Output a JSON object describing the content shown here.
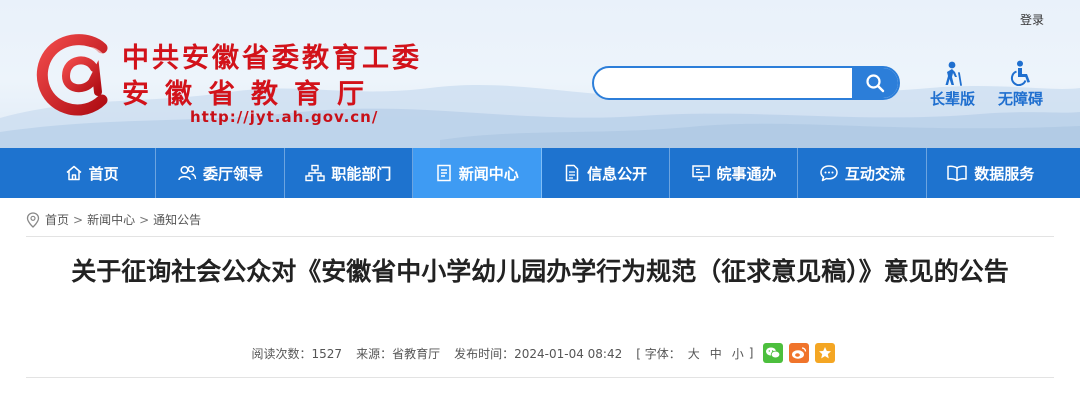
{
  "header": {
    "login": "登录",
    "title_line1": "中共安徽省委教育工委",
    "title_line2": "安徽省教育厅",
    "url": "http://jyt.ah.gov.cn/",
    "search": {
      "placeholder": "",
      "value": ""
    },
    "tools": [
      {
        "label": "长辈版",
        "icon": "elder-icon"
      },
      {
        "label": "无障碍",
        "icon": "accessibility-icon"
      }
    ]
  },
  "nav": {
    "items": [
      {
        "label": "首页",
        "icon": "home-icon",
        "active": false
      },
      {
        "label": "委厅领导",
        "icon": "leaders-icon",
        "active": false
      },
      {
        "label": "职能部门",
        "icon": "org-chart-icon",
        "active": false
      },
      {
        "label": "新闻中心",
        "icon": "news-icon",
        "active": true
      },
      {
        "label": "信息公开",
        "icon": "document-icon",
        "active": false
      },
      {
        "label": "皖事通办",
        "icon": "monitor-icon",
        "active": false
      },
      {
        "label": "互动交流",
        "icon": "chat-icon",
        "active": false
      },
      {
        "label": "数据服务",
        "icon": "book-icon",
        "active": false
      }
    ]
  },
  "breadcrumb": [
    "首页",
    "新闻中心",
    "通知公告"
  ],
  "article": {
    "title": "关于征询社会公众对《安徽省中小学幼儿园办学行为规范（征求意见稿）》意见的公告",
    "reads": "阅读次数：1527",
    "source": "来源：省教育厅",
    "published": "发布时间：2024-01-04 08:42",
    "font_label": "[ 字体：",
    "font_large": "大",
    "font_medium": "中",
    "font_small": "小",
    "font_close": "]"
  },
  "colors": {
    "brand_red": "#d2121a",
    "nav_blue": "#1e73cf",
    "nav_active": "#3e9bf3",
    "wechat": "#4cbf3d",
    "weibo": "#f0742b",
    "favorite": "#f4a623"
  }
}
